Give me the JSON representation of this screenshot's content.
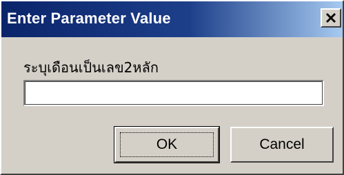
{
  "dialog": {
    "title": "Enter Parameter Value",
    "close_glyph": "×",
    "prompt": "ระบุเดือนเป็นเลข2หลัก",
    "input_value": "",
    "ok_label": "OK",
    "cancel_label": "Cancel"
  },
  "icons": {
    "close": "close-icon"
  },
  "colors": {
    "titlebar_start": "#0a246a",
    "titlebar_end": "#a6caf0",
    "face": "#d4d0c8"
  }
}
